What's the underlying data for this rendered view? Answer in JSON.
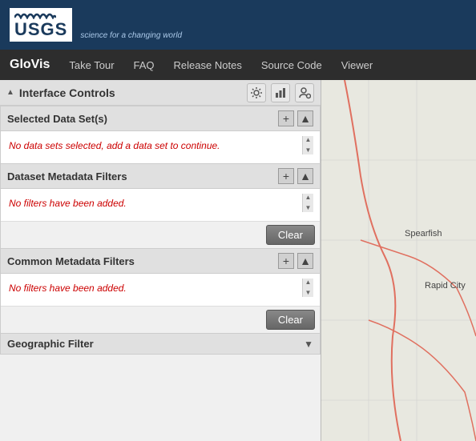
{
  "usgs": {
    "brand": "USGS",
    "tagline": "science for a changing world"
  },
  "nav": {
    "brand": "GloVis",
    "links": [
      "Take Tour",
      "FAQ",
      "Release Notes",
      "Source Code",
      "Viewer"
    ]
  },
  "interface_controls": {
    "title": "Interface Controls",
    "triangle": "▲"
  },
  "selected_datasets": {
    "title": "Selected Data Set(s)",
    "message": "No data sets selected, add a data set to continue.",
    "plus_label": "+",
    "arrow_label": "▲"
  },
  "dataset_metadata": {
    "title": "Dataset Metadata Filters",
    "message": "No filters have been added.",
    "plus_label": "+",
    "arrow_label": "▲",
    "clear_label": "Clear"
  },
  "common_metadata": {
    "title": "Common Metadata Filters",
    "message": "No filters have been added.",
    "plus_label": "+",
    "arrow_label": "▲",
    "clear_label": "Clear"
  },
  "geographic_filter": {
    "title": "Geographic Filter",
    "arrow_label": "▼"
  },
  "map": {
    "label1": "Spearfish",
    "label2": "Rapid City"
  }
}
